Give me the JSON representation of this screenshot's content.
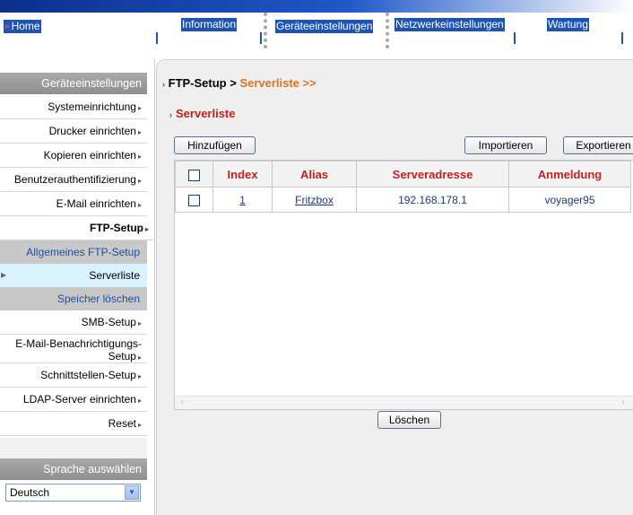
{
  "topnav": {
    "home": "Home",
    "tabs": [
      "Information",
      "Geräteeinstellungen",
      "Netzwerkeinstellungen",
      "Wartung"
    ]
  },
  "sidebar": {
    "section_title": "Geräteeinstellungen",
    "items": [
      "Systemeinrichtung",
      "Drucker einrichten",
      "Kopieren einrichten",
      "Benutzerauthentifizierung",
      "E-Mail einrichten",
      "FTP-Setup"
    ],
    "ftp_subitems": {
      "general": "Allgemeines FTP-Setup",
      "serverlist": "Serverliste",
      "delete_memory": "Speicher löschen"
    },
    "items_after": [
      "SMB-Setup",
      "E-Mail-Benachrichtigungs-",
      "Setup",
      "Schnittstellen-Setup",
      "LDAP-Server einrichten",
      "Reset"
    ],
    "language_title": "Sprache auswählen",
    "language_value": "Deutsch"
  },
  "main": {
    "breadcrumb": {
      "parent": "FTP-Setup",
      "sep": " > ",
      "current": "Serverliste >>"
    },
    "section_title": "Serverliste",
    "buttons": {
      "add": "Hinzufügen",
      "import": "Importieren",
      "export": "Exportieren",
      "delete": "Löschen"
    },
    "table": {
      "headers": [
        "Index",
        "Alias",
        "Serveradresse",
        "Anmeldung"
      ],
      "rows": [
        {
          "index": "1",
          "alias": "Fritzbox",
          "server": "192.168.178.1",
          "login": "voyager95"
        }
      ]
    }
  },
  "colors": {
    "accent_blue": "#1d53b5",
    "heading_red": "#c81e1e",
    "breadcrumb_orange": "#e0731e"
  }
}
